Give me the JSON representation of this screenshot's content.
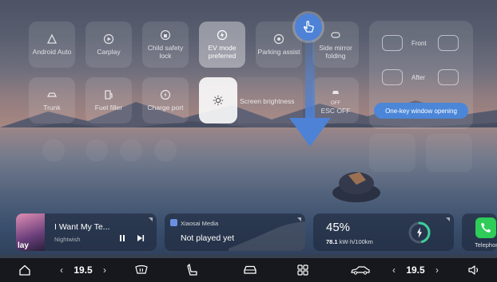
{
  "quick_controls": {
    "row1": [
      {
        "label": "Android Auto",
        "icon": "android-auto-icon"
      },
      {
        "label": "Carplay",
        "icon": "carplay-icon"
      },
      {
        "label": "Child safety lock",
        "icon": "child-lock-icon"
      },
      {
        "label": "EV mode preferred",
        "icon": "ev-mode-icon",
        "active": true
      },
      {
        "label": "Parking assist",
        "icon": "parking-assist-icon"
      },
      {
        "label": "Side mirror folding",
        "icon": "mirror-fold-icon"
      }
    ],
    "row2": [
      {
        "label": "Trunk",
        "icon": "trunk-icon"
      },
      {
        "label": "Fuel filler",
        "icon": "fuel-filler-icon"
      },
      {
        "label": "Charge port",
        "icon": "charge-port-icon"
      }
    ],
    "brightness_label": "Screen brightness",
    "esc": {
      "label": "ESC OFF",
      "status": "OFF"
    }
  },
  "windows": {
    "front_label": "Front",
    "after_label": "After",
    "one_key_label": "One-key window opening"
  },
  "media_card": {
    "song_title": "I Want My Te...",
    "artist": "Nightwish",
    "album_tag": "lay"
  },
  "xiaosai_card": {
    "source": "Xiaosai Media",
    "status": "Not played yet"
  },
  "energy_card": {
    "percent": "45%",
    "consumption_value": "78.1",
    "consumption_unit": "kW·h/100km",
    "level": 0.45
  },
  "phone_card": {
    "label": "Telephone"
  },
  "dock": {
    "left_temp": "19.5",
    "right_temp": "19.5"
  },
  "colors": {
    "accent": "#4b86d8",
    "phone": "#2ecc58",
    "energy_ring": "#3ecf9a"
  }
}
